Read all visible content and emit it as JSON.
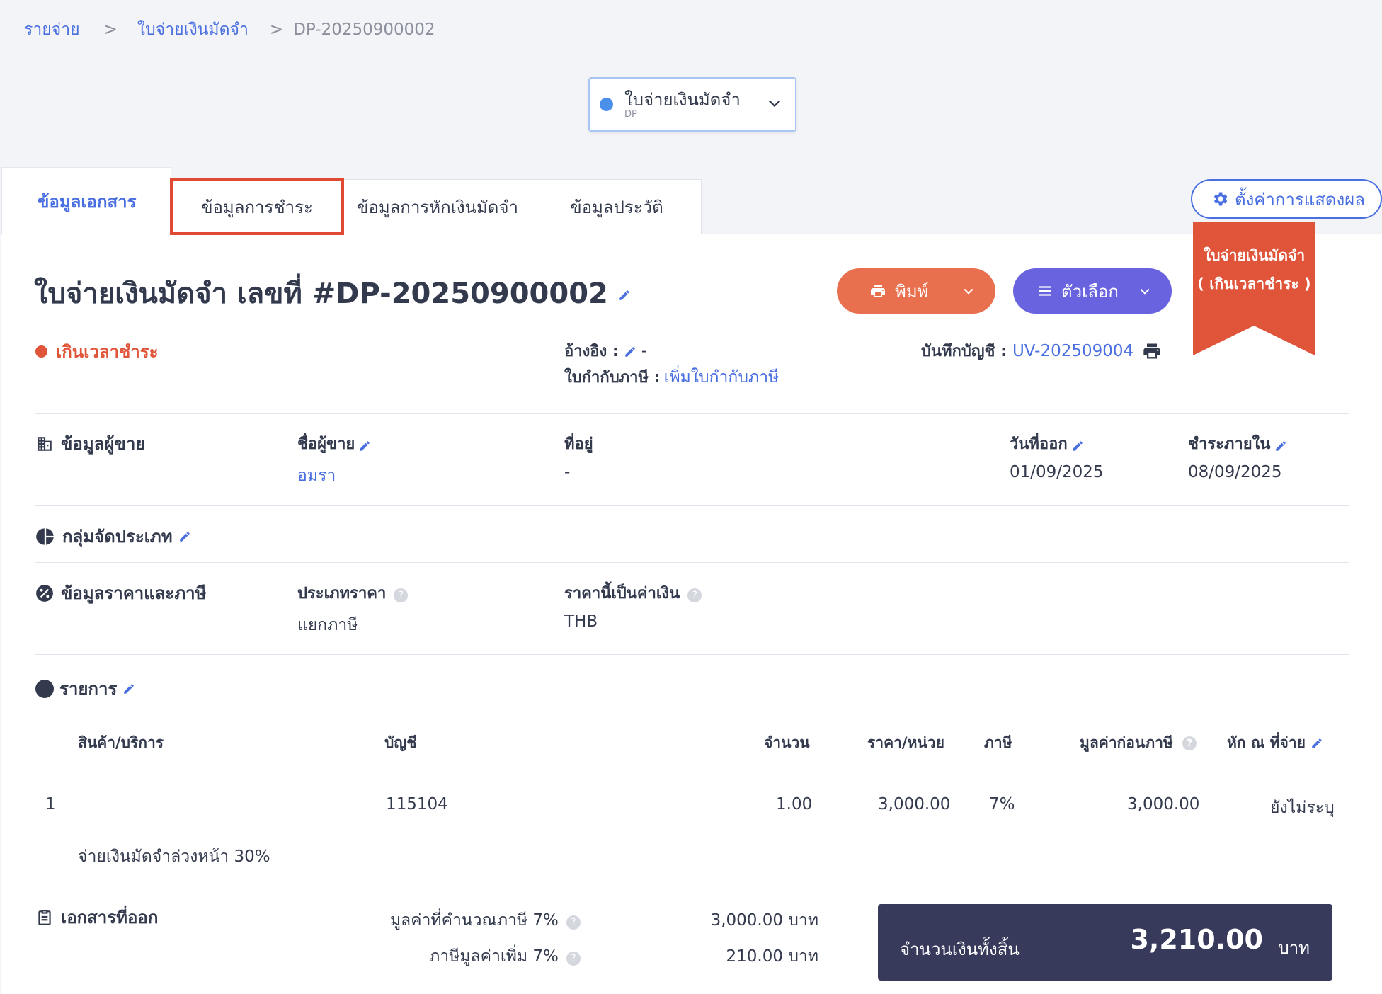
{
  "breadcrumb": {
    "item1": "รายจ่าย",
    "sep": ">",
    "item2": "ใบจ่ายเงินมัดจำ",
    "current": "DP-20250900002"
  },
  "doctype": {
    "label": "ใบจ่ายเงินมัดจำ",
    "code": "DP"
  },
  "tabs": [
    "ข้อมูลเอกสาร",
    "ข้อมูลการชำระ",
    "ข้อมูลการหักเงินมัดจำ",
    "ข้อมูลประวัติ"
  ],
  "settings_label": "ตั้งค่าการแสดงผล",
  "ribbon": {
    "line1": "ใบจ่ายเงินมัดจำ",
    "line2": "( เกินเวลาชำระ )"
  },
  "title": "ใบจ่ายเงินมัดจำ เลขที่ #DP-20250900002",
  "buttons": {
    "print": "พิมพ์",
    "options": "ตัวเลือก"
  },
  "status": "เกินเวลาชำระ",
  "reference": {
    "label": "อ้างอิง :",
    "value": "-"
  },
  "tax_invoice": {
    "label": "ใบกำกับภาษี :",
    "link": "เพิ่มใบกำกับภาษี"
  },
  "journal": {
    "label": "บันทึกบัญชี :",
    "link": "UV-202509004"
  },
  "seller": {
    "section": "ข้อมูลผู้ขาย",
    "name_label": "ชื่อผู้ขาย",
    "name": "อมรา",
    "address_label": "ที่อยู่",
    "address": "-",
    "issue_label": "วันที่ออก",
    "issue_date": "01/09/2025",
    "due_label": "ชำระภายใน",
    "due_date": "08/09/2025"
  },
  "category_section": "กลุ่มจัดประเภท",
  "pricing": {
    "section": "ข้อมูลราคาและภาษี",
    "price_type_label": "ประเภทราคา",
    "price_type": "แยกภาษี",
    "currency_label": "ราคานี้เป็นค่าเงิน",
    "currency": "THB"
  },
  "items": {
    "section": "รายการ",
    "headers": [
      "สินค้า/บริการ",
      "บัญชี",
      "จำนวน",
      "ราคา/หน่วย",
      "ภาษี",
      "มูลค่าก่อนภาษี",
      "หัก ณ ที่จ่าย"
    ],
    "row": {
      "no": "1",
      "account": "115104",
      "qty": "1.00",
      "unit_price": "3,000.00",
      "tax": "7%",
      "pre_tax": "3,000.00",
      "wht": "ยังไม่ระบุ"
    },
    "description": "จ่ายเงินมัดจำล่วงหน้า 30%"
  },
  "issued_section": "เอกสารที่ออก",
  "summary": {
    "taxable_label": "มูลค่าที่คำนวณภาษี 7%",
    "taxable": "3,000.00 บาท",
    "vat_label": "ภาษีมูลค่าเพิ่ม 7%",
    "vat": "210.00 บาท"
  },
  "total": {
    "label": "จำนวนเงินทั้งสิ้น",
    "amount": "3,210.00",
    "unit": "บาท"
  },
  "colors": {
    "accent": "#4a6fe0",
    "overdue": "#e0553a",
    "print": "#e8704f",
    "options": "#6a63e0",
    "total_bg": "#383a5c"
  }
}
